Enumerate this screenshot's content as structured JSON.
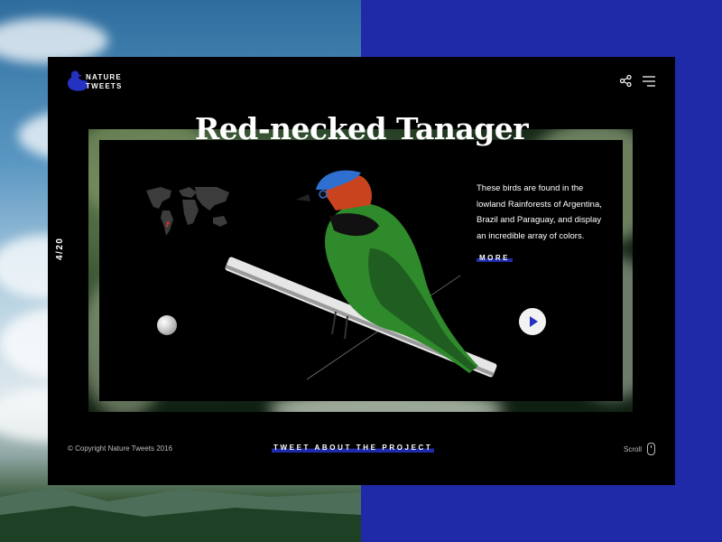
{
  "brand": {
    "line1": "NATURE",
    "line2": "TWEETS"
  },
  "header": {
    "share_icon": "share-icon",
    "menu_icon": "hamburger-menu-icon"
  },
  "hero": {
    "title": "Red-necked Tanager",
    "pager": "4/20",
    "description": "These birds are found in the lowland Rainforests of Argentina, Brazil and Paraguay, and display an incredible array of colors.",
    "more_label": "MORE",
    "play_icon": "play-icon"
  },
  "footer": {
    "copyright": "© Copyright Nature Tweets 2016",
    "tweet_label": "TWEET ABOUT THE PROJECT",
    "scroll_label": "Scroll",
    "scroll_icon": "mouse-icon"
  },
  "colors": {
    "accent": "#1f2aa8",
    "card": "#000000",
    "text": "#ffffff"
  }
}
